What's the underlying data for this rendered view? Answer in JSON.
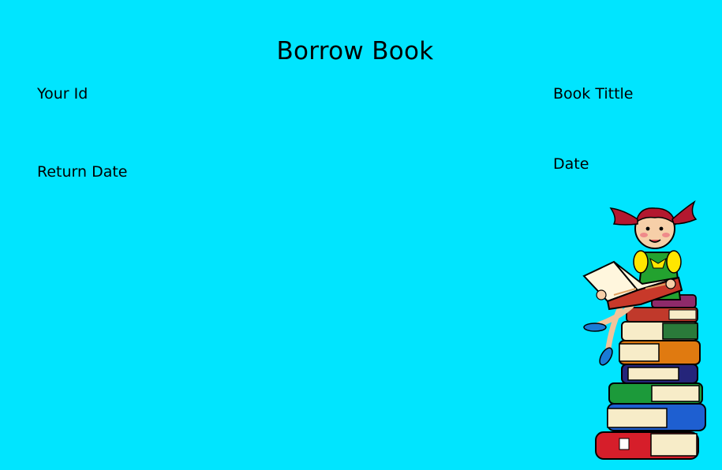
{
  "page": {
    "title": "Borrow Book"
  },
  "form": {
    "your_id_label": "Your Id",
    "return_date_label": "Return Date",
    "book_title_label": "Book Tittle",
    "date_label": "Date"
  },
  "theme": {
    "background": "#00e5ff"
  },
  "illustration": {
    "icon": "girl-reading-on-book-stack-icon"
  }
}
